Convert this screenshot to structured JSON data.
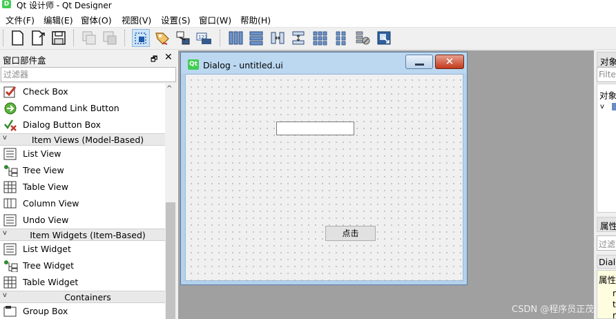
{
  "app": {
    "icon_glyph": "D",
    "title": "Qt 设计师 - Qt Designer"
  },
  "menu": [
    "文件(F)",
    "编辑(E)",
    "窗体(O)",
    "视图(V)",
    "设置(S)",
    "窗口(W)",
    "帮助(H)"
  ],
  "toolbar": {
    "buttons": [
      {
        "name": "new-form-icon"
      },
      {
        "name": "open-form-icon"
      },
      {
        "name": "save-form-icon"
      },
      {
        "name": "copy-icon"
      },
      {
        "name": "paste-icon"
      },
      {
        "name": "edit-widgets-icon",
        "active": true
      },
      {
        "name": "edit-signals-slots-icon"
      },
      {
        "name": "edit-buddies-icon"
      },
      {
        "name": "edit-tab-order-icon"
      },
      {
        "name": "layout-horizontal-icon"
      },
      {
        "name": "layout-vertical-icon"
      },
      {
        "name": "layout-h-splitter-icon"
      },
      {
        "name": "layout-v-splitter-icon"
      },
      {
        "name": "layout-grid-icon"
      },
      {
        "name": "layout-form-icon"
      },
      {
        "name": "break-layout-icon"
      },
      {
        "name": "adjust-size-icon"
      }
    ]
  },
  "widget_box": {
    "title": "窗口部件盒",
    "float_glyph": "🗗",
    "close_glyph": "✕",
    "filter_placeholder": "过滤器",
    "items": [
      {
        "type": "item",
        "label": "Check Box",
        "icon": "check-box-icon"
      },
      {
        "type": "item",
        "label": "Command Link Button",
        "icon": "command-link-button-icon"
      },
      {
        "type": "item",
        "label": "Dialog Button Box",
        "icon": "dialog-button-box-icon"
      },
      {
        "type": "category",
        "label": "Item Views (Model-Based)"
      },
      {
        "type": "item",
        "label": "List View",
        "icon": "list-view-icon"
      },
      {
        "type": "item",
        "label": "Tree View",
        "icon": "tree-view-icon"
      },
      {
        "type": "item",
        "label": "Table View",
        "icon": "table-view-icon"
      },
      {
        "type": "item",
        "label": "Column View",
        "icon": "column-view-icon"
      },
      {
        "type": "item",
        "label": "Undo View",
        "icon": "undo-view-icon"
      },
      {
        "type": "category",
        "label": "Item Widgets (Item-Based)"
      },
      {
        "type": "item",
        "label": "List Widget",
        "icon": "list-widget-icon"
      },
      {
        "type": "item",
        "label": "Tree Widget",
        "icon": "tree-widget-icon"
      },
      {
        "type": "item",
        "label": "Table Widget",
        "icon": "table-widget-icon"
      },
      {
        "type": "category",
        "label": "Containers"
      },
      {
        "type": "item",
        "label": "Group Box",
        "icon": "group-box-icon"
      }
    ]
  },
  "dialog": {
    "icon_glyph": "Qt",
    "title": "Dialog - untitled.ui",
    "close_glyph": "✕",
    "button_label": "点击",
    "line_edit_value": ""
  },
  "object_inspector": {
    "title": "对象",
    "filter_placeholder": "Filter",
    "tree_header": "对象",
    "tree_arrow": "v"
  },
  "property_editor": {
    "title": "属性",
    "filter_placeholder": "过滤",
    "class_label": "Dialo",
    "table_header": "属性",
    "cells": [
      "r",
      "t",
      "r"
    ]
  },
  "watermark": "CSDN @程序员正茂"
}
